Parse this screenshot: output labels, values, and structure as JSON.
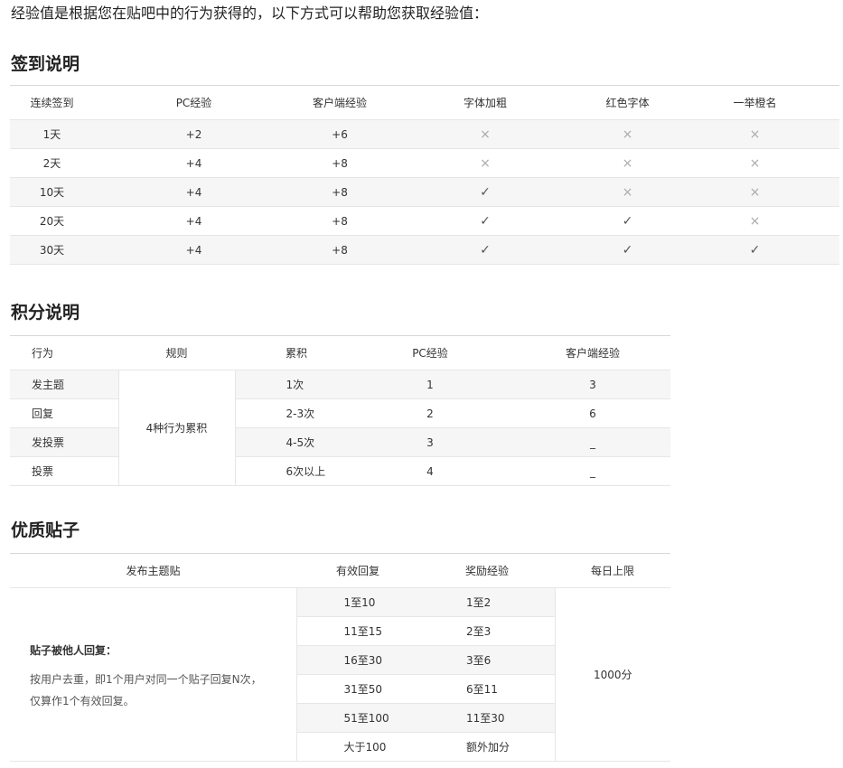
{
  "intro": "经验值是根据您在贴吧中的行为获得的，以下方式可以帮助您获取经验值：",
  "signin": {
    "title": "签到说明",
    "headers": [
      "连续签到",
      "PC经验",
      "客户端经验",
      "字体加粗",
      "红色字体",
      "一举橙名"
    ],
    "rows": [
      {
        "days": "1天",
        "pc": "+2",
        "client": "+6",
        "bold": "no",
        "red": "no",
        "orange": "no"
      },
      {
        "days": "2天",
        "pc": "+4",
        "client": "+8",
        "bold": "no",
        "red": "no",
        "orange": "no"
      },
      {
        "days": "10天",
        "pc": "+4",
        "client": "+8",
        "bold": "yes",
        "red": "no",
        "orange": "no"
      },
      {
        "days": "20天",
        "pc": "+4",
        "client": "+8",
        "bold": "yes",
        "red": "yes",
        "orange": "no"
      },
      {
        "days": "30天",
        "pc": "+4",
        "client": "+8",
        "bold": "yes",
        "red": "yes",
        "orange": "yes"
      }
    ],
    "icons": {
      "yes": "check-icon",
      "no": "cross-icon"
    }
  },
  "points": {
    "title": "积分说明",
    "headers": [
      "行为",
      "规则",
      "累积",
      "PC经验",
      "客户端经验"
    ],
    "rule": "4种行为累积",
    "rows": [
      {
        "action": "发主题",
        "accum": "1次",
        "pc": "1",
        "client": "3"
      },
      {
        "action": "回复",
        "accum": "2-3次",
        "pc": "2",
        "client": "6"
      },
      {
        "action": "发投票",
        "accum": "4-5次",
        "pc": "3",
        "client": "_"
      },
      {
        "action": "投票",
        "accum": "6次以上",
        "pc": "4",
        "client": "_"
      }
    ]
  },
  "quality": {
    "title": "优质贴子",
    "headers": [
      "发布主题贴",
      "有效回复",
      "奖励经验",
      "每日上限"
    ],
    "desc_title": "贴子被他人回复：",
    "desc_lines": [
      "按用户去重，即1个用户对同一个贴子回复N次，",
      "仅算作1个有效回复。"
    ],
    "daily_limit": "1000分",
    "rows": [
      {
        "replies": "1至10",
        "reward": "1至2"
      },
      {
        "replies": "11至15",
        "reward": "2至3"
      },
      {
        "replies": "16至30",
        "reward": "3至6"
      },
      {
        "replies": "31至50",
        "reward": "6至11"
      },
      {
        "replies": "51至100",
        "reward": "11至30"
      },
      {
        "replies": "大于100",
        "reward": "额外加分"
      }
    ]
  },
  "colors": {
    "alt_row": "#f6f6f6",
    "border": "#e6e6e6",
    "text": "#333333"
  }
}
